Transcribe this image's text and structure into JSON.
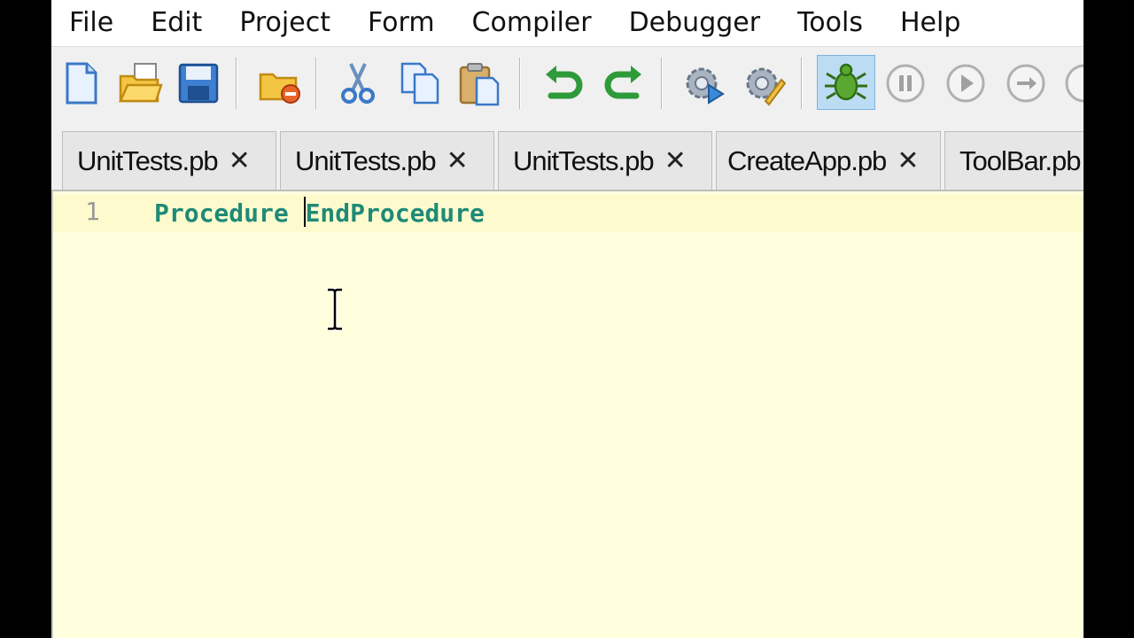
{
  "menu": [
    "File",
    "Edit",
    "Project",
    "Form",
    "Compiler",
    "Debugger",
    "Tools",
    "Help"
  ],
  "toolbar": {
    "icons": [
      "new-file-icon",
      "open-file-icon",
      "save-icon",
      "close-file-icon",
      "cut-icon",
      "copy-icon",
      "paste-icon",
      "undo-icon",
      "redo-icon",
      "compile-run-icon",
      "build-icon",
      "debugger-icon",
      "pause-icon",
      "continue-icon",
      "step-icon",
      "stop-icon"
    ],
    "active": "debugger-icon"
  },
  "tabs": [
    {
      "label": "UnitTests.pb",
      "close": "✕"
    },
    {
      "label": "UnitTests.pb",
      "close": "✕"
    },
    {
      "label": "UnitTests.pb",
      "close": "✕"
    },
    {
      "label": "CreateApp.pb",
      "close": "✕"
    },
    {
      "label": "ToolBar.pb",
      "close": ""
    }
  ],
  "editor": {
    "line_number": "1",
    "code_before_caret": "Procedure ",
    "code_after_caret": "EndProcedure",
    "keyword_color": "#1f8a77",
    "background": "#ffffde"
  }
}
